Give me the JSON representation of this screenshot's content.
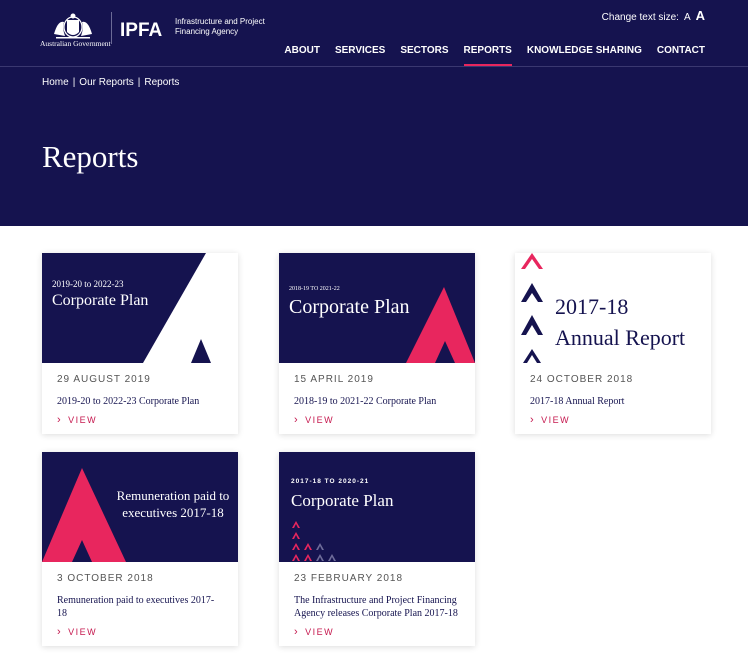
{
  "header": {
    "gov_text": "Australian Government",
    "ipfa_logo": "IPFA",
    "ipfa_tagline": "Infrastructure and Project Financing Agency",
    "text_size_label": "Change text size:",
    "text_size_small": "A",
    "text_size_large": "A",
    "nav": [
      {
        "label": "ABOUT",
        "active": false
      },
      {
        "label": "SERVICES",
        "active": false
      },
      {
        "label": "SECTORS",
        "active": false
      },
      {
        "label": "REPORTS",
        "active": true
      },
      {
        "label": "KNOWLEDGE SHARING",
        "active": false
      },
      {
        "label": "CONTACT",
        "active": false
      }
    ]
  },
  "breadcrumb": [
    "Home",
    "Our Reports",
    "Reports"
  ],
  "page_title": "Reports",
  "colors": {
    "navy": "#15134f",
    "pink": "#e8265e",
    "view": "#c5184e"
  },
  "cards": [
    {
      "thumb_small": "2019-20 to 2022-23",
      "thumb_title": "Corporate Plan",
      "date": "29 AUGUST 2019",
      "desc": "2019-20 to 2022-23 Corporate Plan",
      "view": "VIEW"
    },
    {
      "thumb_small": "2018-19 TO 2021-22",
      "thumb_title": "Corporate Plan",
      "date": "15 APRIL 2019",
      "desc": "2018-19 to 2021-22 Corporate Plan",
      "view": "VIEW"
    },
    {
      "thumb_line1": "2017-18",
      "thumb_line2": "Annual Report",
      "date": "24 OCTOBER 2018",
      "desc": "2017-18 Annual Report",
      "view": "VIEW"
    },
    {
      "thumb_title": "Remuneration paid to executives 2017-18",
      "date": "3 OCTOBER 2018",
      "desc": "Remuneration paid to executives 2017-18",
      "view": "VIEW"
    },
    {
      "thumb_small": "2017-18 TO 2020-21",
      "thumb_title": "Corporate Plan",
      "date": "23 FEBRUARY 2018",
      "desc": "The Infrastructure and Project Financing Agency releases Corporate Plan 2017-18",
      "view": "VIEW"
    }
  ]
}
